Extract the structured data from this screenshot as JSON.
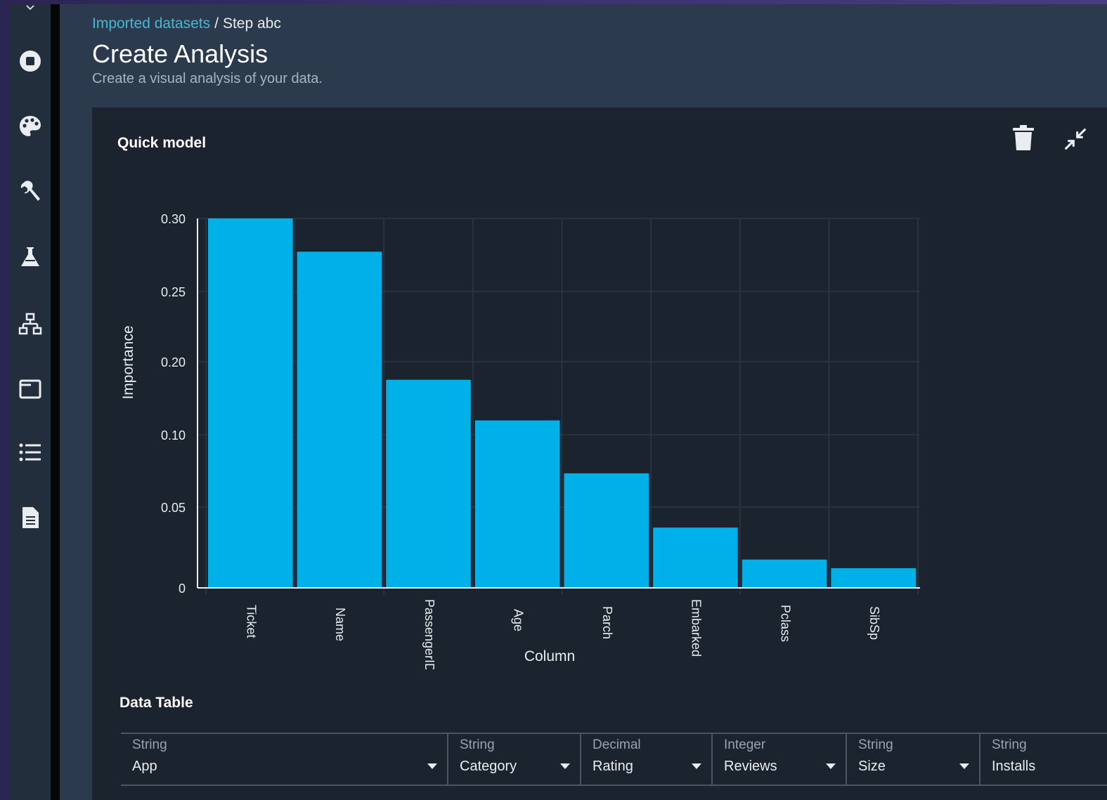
{
  "breadcrumb": {
    "link": "Imported datasets",
    "separator": "/",
    "current": "Step abc"
  },
  "page": {
    "title": "Create Analysis",
    "subtitle": "Create a visual analysis of your data."
  },
  "sidebar": {
    "items": [
      {
        "icon": "stop-icon"
      },
      {
        "icon": "palette-icon"
      },
      {
        "icon": "wrench-icon"
      },
      {
        "icon": "flask-icon"
      },
      {
        "icon": "network-icon"
      },
      {
        "icon": "window-icon"
      },
      {
        "icon": "list-icon"
      },
      {
        "icon": "document-icon"
      }
    ]
  },
  "panel": {
    "title": "Quick model",
    "actions": [
      "trash-icon",
      "collapse-icon"
    ]
  },
  "chart_data": {
    "type": "bar",
    "categories": [
      "Ticket",
      "Name",
      "PassengerID",
      "Age",
      "Parch",
      "Embarked",
      "Pclass",
      "SibSp"
    ],
    "values": [
      0.305,
      0.273,
      0.169,
      0.136,
      0.093,
      0.049,
      0.023,
      0.016
    ],
    "yticks": [
      "0",
      "0.05",
      "0.10",
      "0.20",
      "0.25",
      "0.30"
    ],
    "xlabel": "Column",
    "ylabel": "Importance",
    "ylim": [
      0,
      0.3
    ],
    "bar_color": "#00b0e8",
    "grid": true
  },
  "data_table": {
    "title": "Data Table",
    "columns": [
      {
        "type": "String",
        "name": "App"
      },
      {
        "type": "String",
        "name": "Category"
      },
      {
        "type": "Decimal",
        "name": "Rating"
      },
      {
        "type": "Integer",
        "name": "Reviews"
      },
      {
        "type": "String",
        "name": "Size"
      },
      {
        "type": "String",
        "name": "Installs"
      }
    ]
  },
  "colors": {
    "accent": "#44b9d6",
    "panel": "#1b232e",
    "background": "#2c3a4d"
  }
}
